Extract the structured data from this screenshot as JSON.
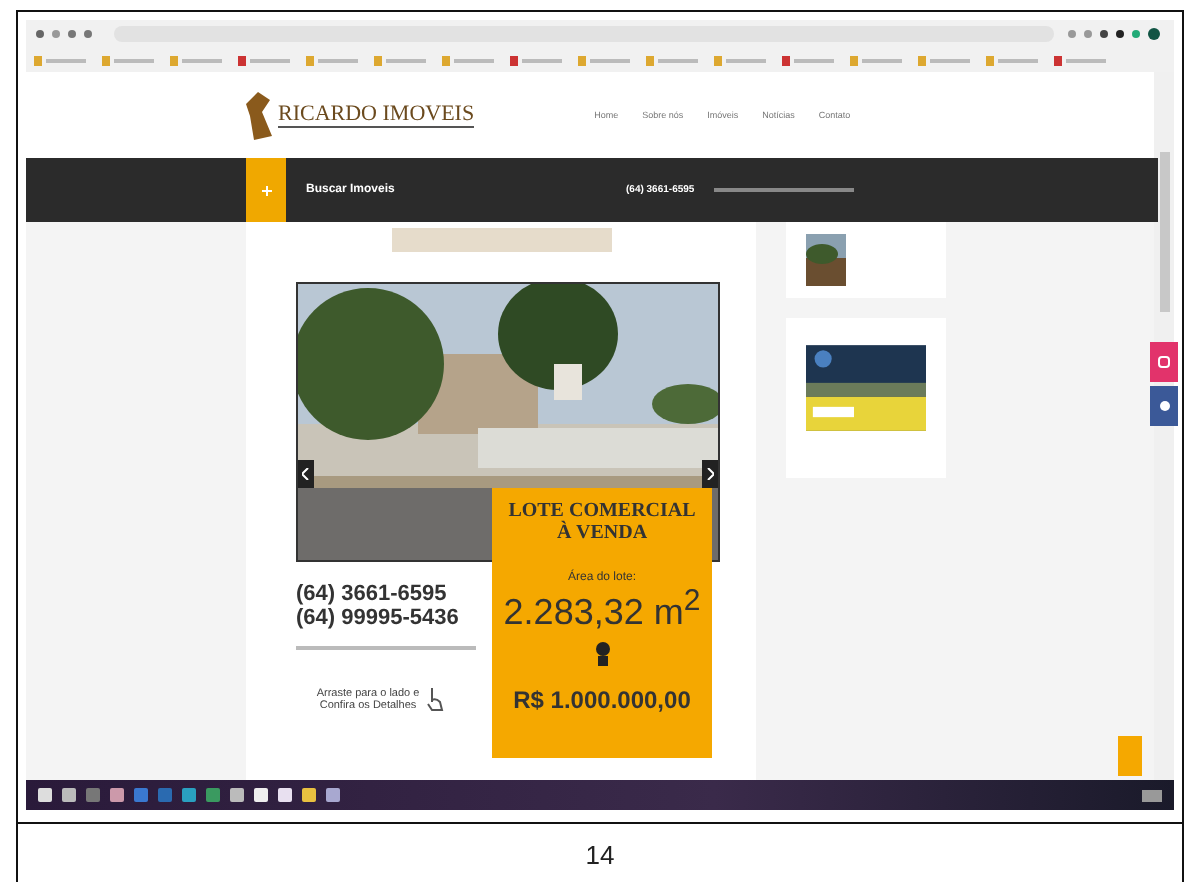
{
  "site": {
    "logo": "RICARDO IMOVEIS",
    "nav": [
      "Home",
      "Sobre nós",
      "Imóveis",
      "Notícias",
      "Contato"
    ]
  },
  "search_bar": {
    "label": "Buscar Imoveis",
    "phone": "(64) 3661-6595"
  },
  "listing": {
    "phones": [
      "(64) 3661-6595",
      "(64) 99995-5436"
    ],
    "swipe_hint": "Arraste para o lado e Confira os Detalhes",
    "title": "LOTE COMERCIAL",
    "subtitle": "À VENDA",
    "area_label": "Área do lote:",
    "area": "2.283,32 m$^{2}$",
    "price": "R$ 1.000.000,00"
  },
  "page_number": "14"
}
